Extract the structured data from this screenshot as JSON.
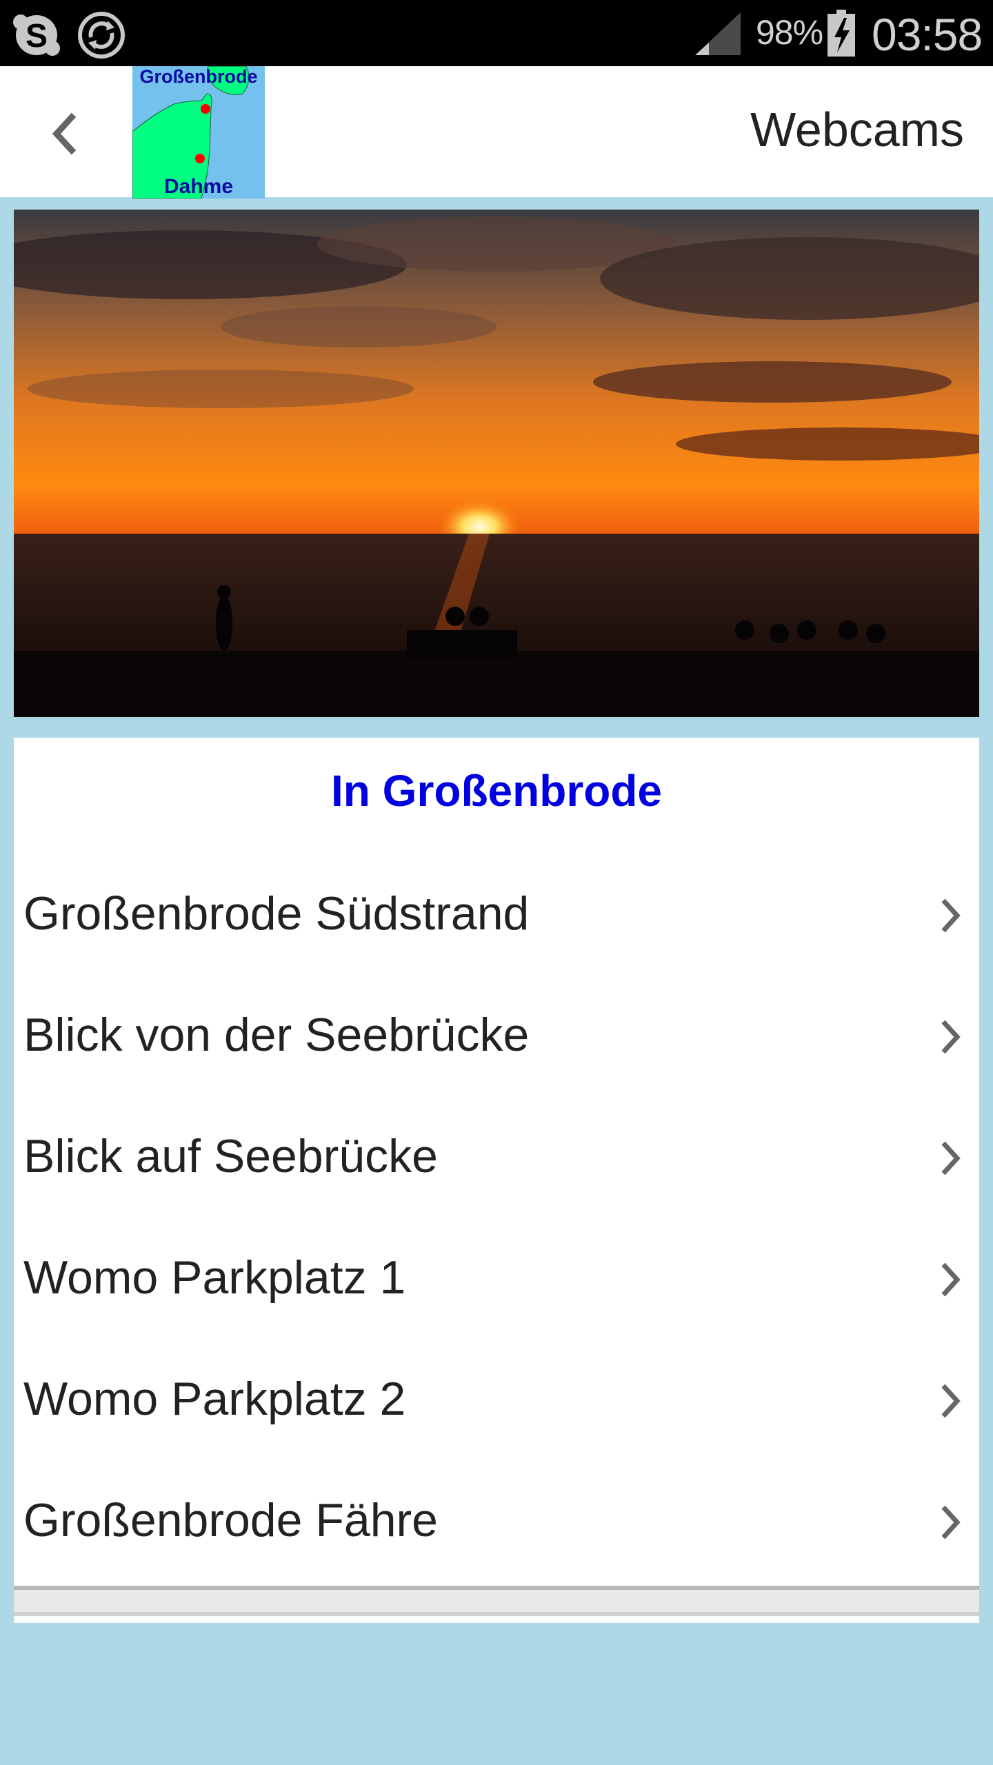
{
  "status_bar": {
    "battery_percent": "98%",
    "time": "03:58",
    "icons": [
      "skype-icon",
      "sync-icon",
      "signal-icon",
      "battery-charging-icon"
    ]
  },
  "app_bar": {
    "title": "Webcams",
    "logo": {
      "top_label": "Großenbrode",
      "bottom_label": "Dahme"
    }
  },
  "colors": {
    "background": "#add8e6",
    "section_title": "#0000e0",
    "map_land": "#00ff80",
    "map_water": "#74c1ee",
    "map_marker": "#ff0000"
  },
  "section": {
    "title": "In Großenbrode",
    "items": [
      {
        "label": "Großenbrode Südstrand"
      },
      {
        "label": "Blick von der Seebrücke"
      },
      {
        "label": "Blick auf Seebrücke"
      },
      {
        "label": "Womo Parkplatz 1"
      },
      {
        "label": "Womo Parkplatz 2"
      },
      {
        "label": "Großenbrode Fähre"
      }
    ]
  }
}
